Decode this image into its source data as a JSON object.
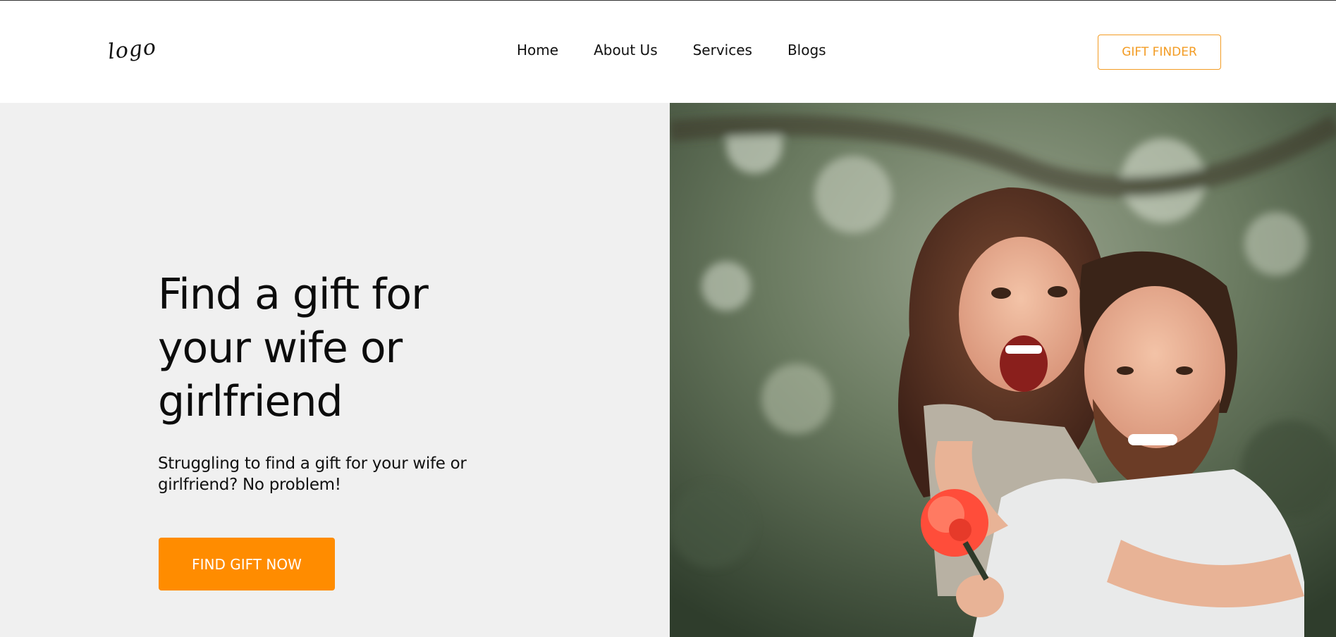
{
  "header": {
    "logo_text": "logo",
    "nav": [
      {
        "label": "Home"
      },
      {
        "label": "About Us"
      },
      {
        "label": "Services"
      },
      {
        "label": "Blogs"
      }
    ],
    "gift_finder_label": "GIFT FINDER"
  },
  "hero": {
    "title": "Find a gift for your wife or girlfriend",
    "subtitle": "Struggling to find a gift for your wife or girlfriend? No problem!",
    "cta_label": "FIND GIFT NOW",
    "photo_subject": "couple-piggyback-photo"
  },
  "colors": {
    "accent": "#ff8c00",
    "accent_outline": "#f39c24",
    "hero_bg": "#f0f0f0",
    "text": "#111111"
  }
}
